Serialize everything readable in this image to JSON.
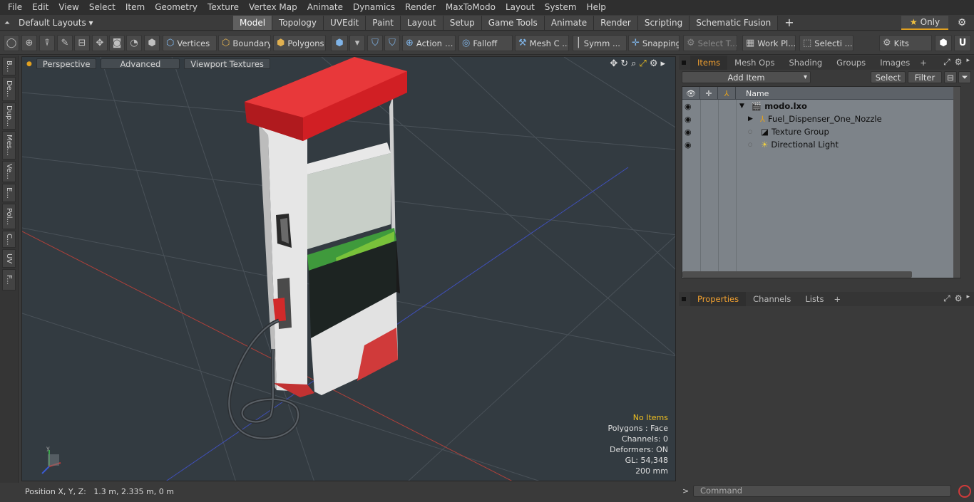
{
  "menu": [
    "File",
    "Edit",
    "View",
    "Select",
    "Item",
    "Geometry",
    "Texture",
    "Vertex Map",
    "Animate",
    "Dynamics",
    "Render",
    "MaxToModo",
    "Layout",
    "System",
    "Help"
  ],
  "layout_selector": "Default Layouts ▾",
  "tabs": [
    "Model",
    "Topology",
    "UVEdit",
    "Paint",
    "Layout",
    "Setup",
    "Game Tools",
    "Animate",
    "Render",
    "Scripting",
    "Schematic Fusion"
  ],
  "active_tab": "Model",
  "only_label": "Only",
  "toolbar": {
    "vertices": "Vertices",
    "boundary": "Boundary",
    "polygons": "Polygons",
    "action": "Action",
    "falloff": "Falloff",
    "mesh_c": "Mesh C ...",
    "symm": "Symm ...",
    "snapping": "Snapping",
    "select_t": "Select T...",
    "work_pl": "Work Pl...",
    "selecti": "Selecti ...",
    "kits": "Kits"
  },
  "left_tabs": [
    "B...",
    "De...",
    "Dup...",
    "Mes...",
    "Ve...",
    "E...",
    "Pol...",
    "C...",
    "UV",
    "F..."
  ],
  "viewport": {
    "perspective": "Perspective",
    "advanced": "Advanced",
    "textures": "Viewport Textures",
    "stats": {
      "items": "No Items",
      "polygons": "Polygons : Face",
      "channels": "Channels: 0",
      "deformers": "Deformers: ON",
      "gl": "GL: 54,348",
      "scale": "200 mm"
    }
  },
  "status": {
    "label": "Position X, Y, Z:",
    "value": "1.3 m, 2.335 m, 0 m"
  },
  "items_panel": {
    "tabs": [
      "Items",
      "Mesh Ops",
      "Shading",
      "Groups",
      "Images"
    ],
    "add_item": "Add Item",
    "select": "Select",
    "filter": "Filter",
    "name_header": "Name",
    "rows": [
      {
        "name": "modo.lxo"
      },
      {
        "name": "Fuel_Dispenser_One_Nozzle"
      },
      {
        "name": "Texture Group"
      },
      {
        "name": "Directional Light"
      }
    ]
  },
  "props_panel": {
    "tabs": [
      "Properties",
      "Channels",
      "Lists"
    ]
  },
  "command_placeholder": "Command"
}
